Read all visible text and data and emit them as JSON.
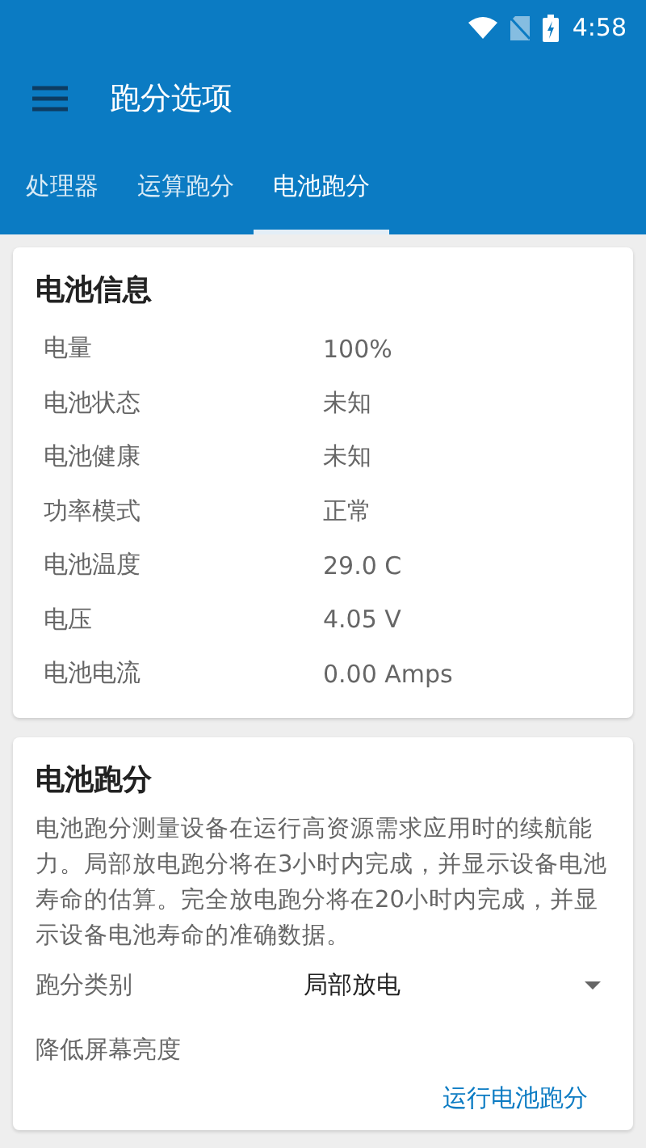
{
  "status_bar": {
    "time": "4:58"
  },
  "app_bar": {
    "title": "跑分选项"
  },
  "tabs": [
    {
      "label": "处理器",
      "selected": false
    },
    {
      "label": "运算跑分",
      "selected": false
    },
    {
      "label": "电池跑分",
      "selected": true
    }
  ],
  "battery_info": {
    "title": "电池信息",
    "rows": [
      {
        "label": "电量",
        "value": "100%"
      },
      {
        "label": "电池状态",
        "value": "未知"
      },
      {
        "label": "电池健康",
        "value": "未知"
      },
      {
        "label": "功率模式",
        "value": "正常"
      },
      {
        "label": "电池温度",
        "value": "29.0 C"
      },
      {
        "label": "电压",
        "value": "4.05 V"
      },
      {
        "label": "电池电流",
        "value": "0.00 Amps"
      }
    ]
  },
  "battery_benchmark": {
    "title": "电池跑分",
    "description": "电池跑分测量设备在运行高资源需求应用时的续航能力。局部放电跑分将在3小时内完成，并显示设备电池寿命的估算。完全放电跑分将在20小时内完成，并显示设备电池寿命的准确数据。",
    "settings": [
      {
        "kind": "dropdown",
        "label": "跑分类别",
        "value": "局部放电"
      },
      {
        "kind": "label",
        "label": "降低屏幕亮度"
      }
    ],
    "action": "运行电池跑分"
  }
}
